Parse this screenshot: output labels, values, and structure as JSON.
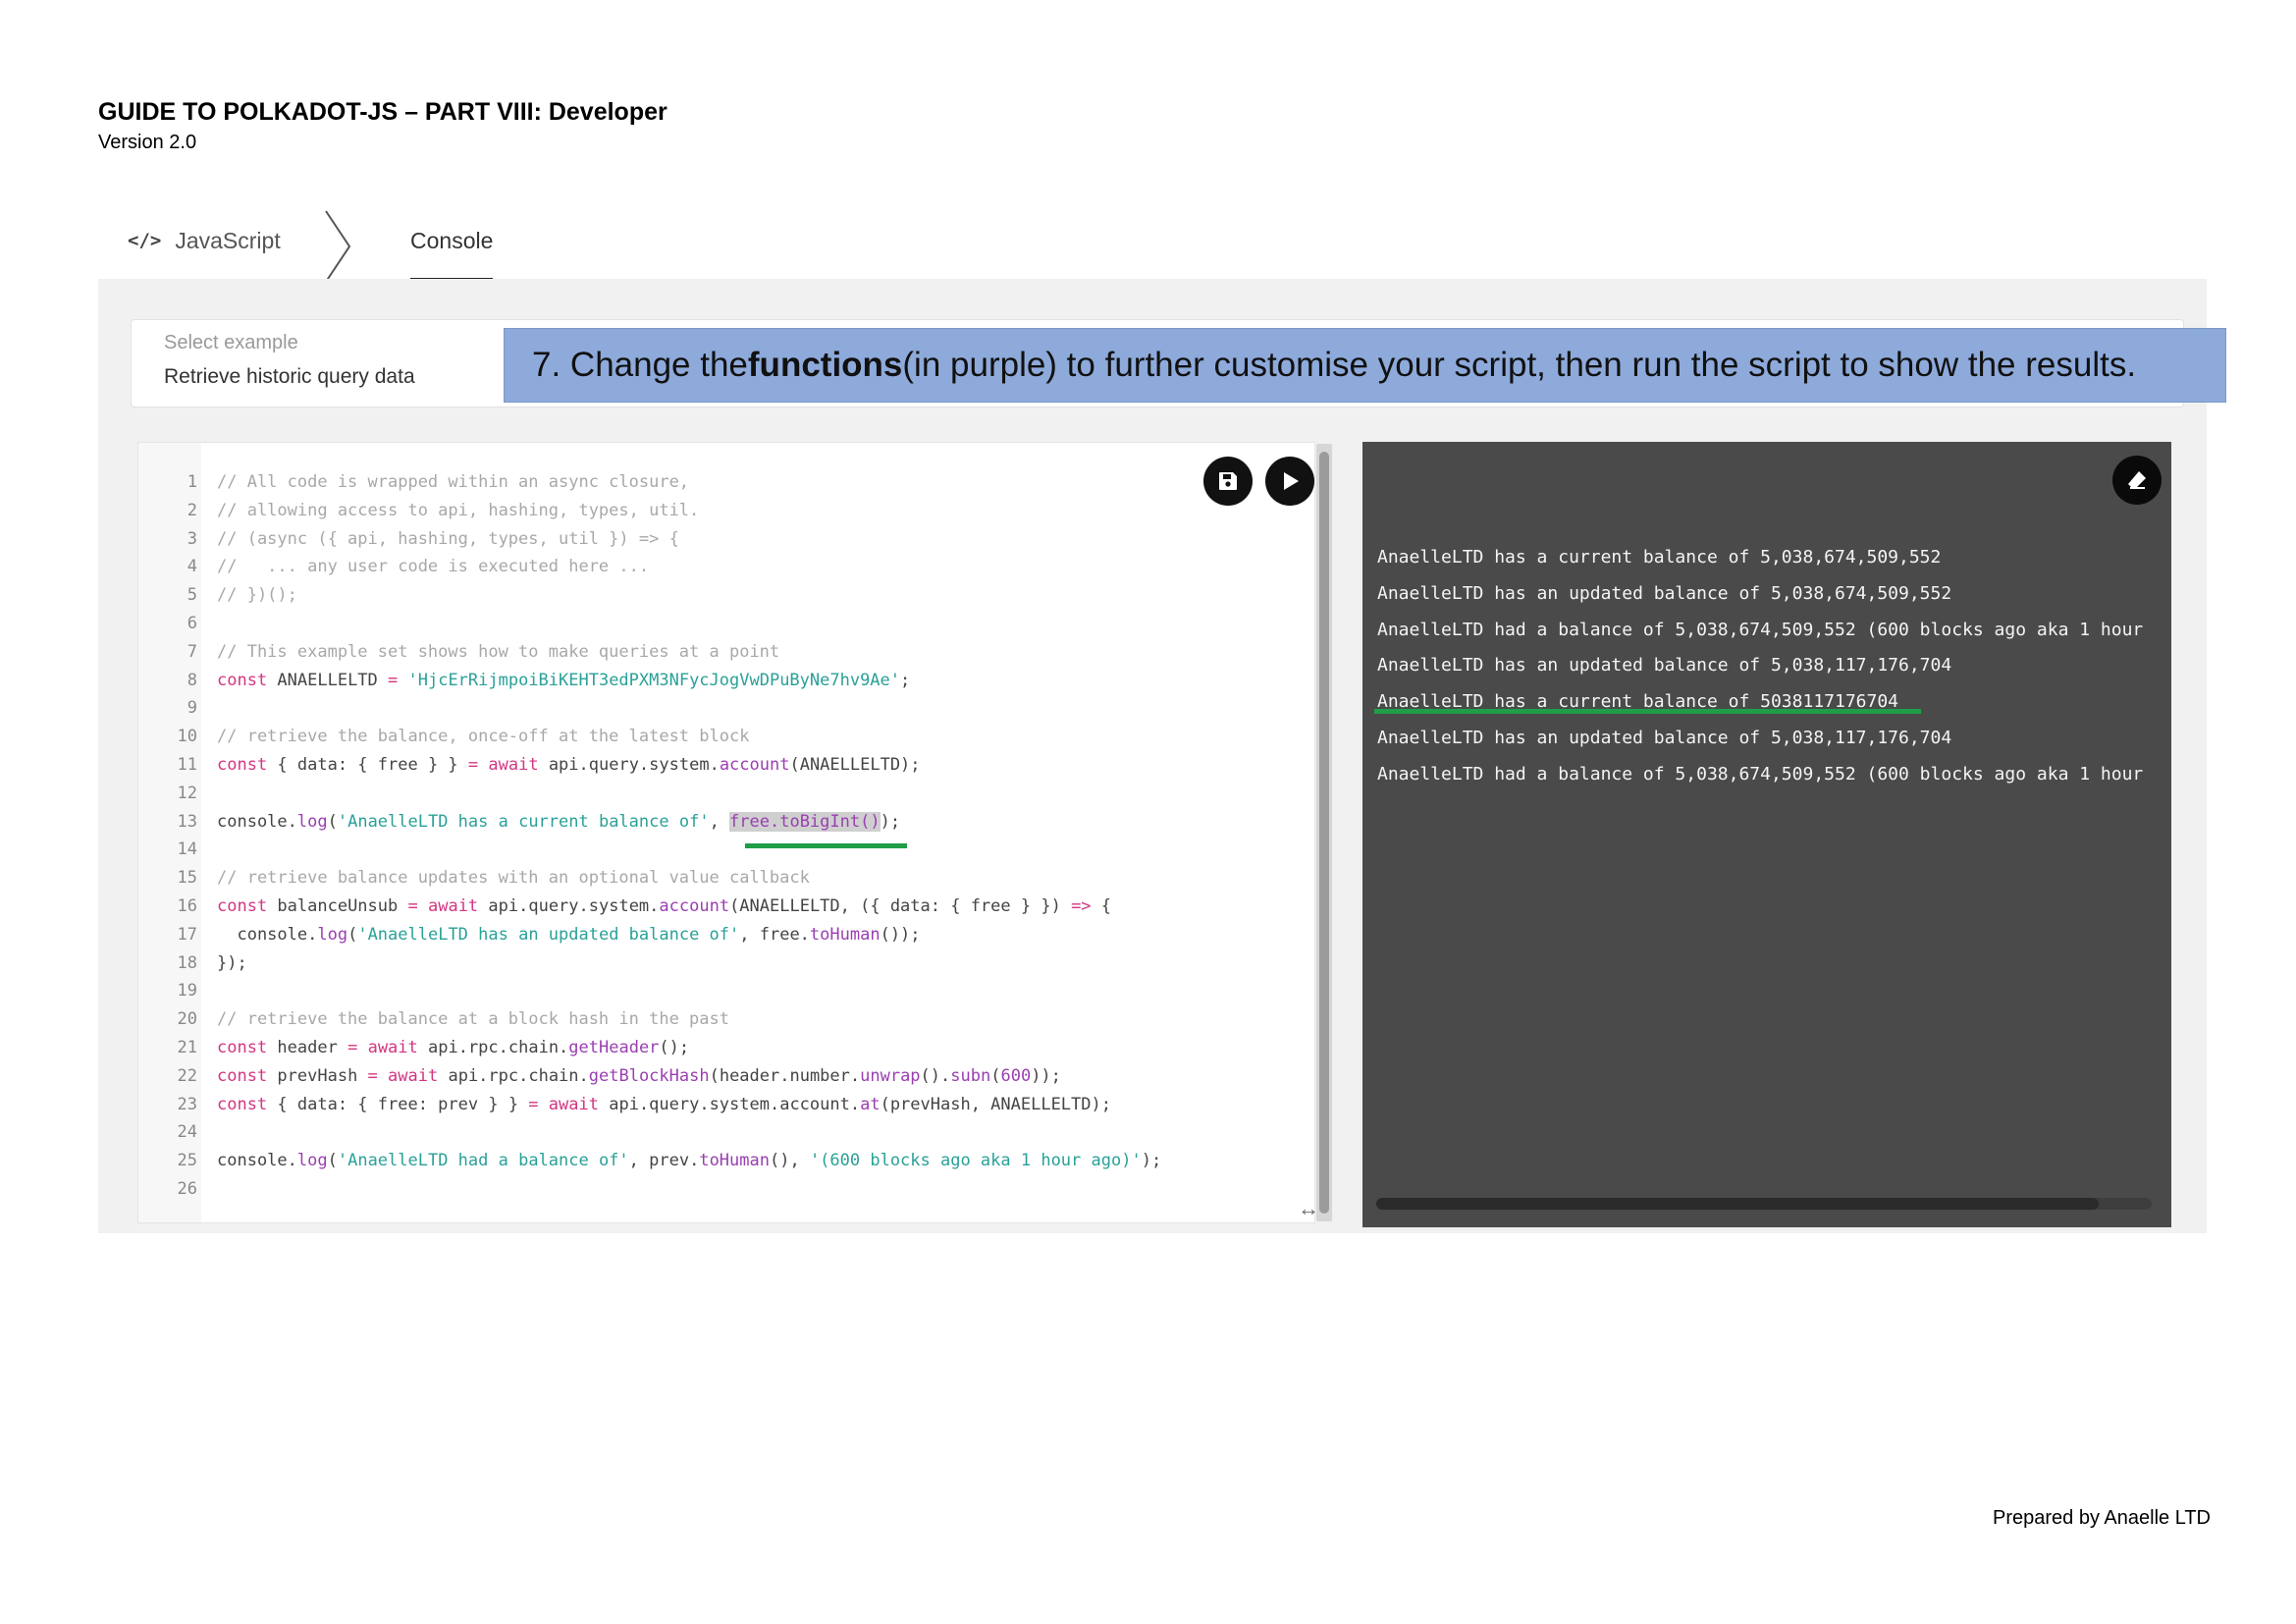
{
  "document": {
    "title": "GUIDE TO POLKADOT-JS – PART VIII: Developer",
    "version": "Version 2.0",
    "footer": "Prepared by Anaelle LTD"
  },
  "tabs": [
    {
      "label": "JavaScript",
      "icon": "code-icon",
      "active": false
    },
    {
      "label": "Console",
      "active": true
    }
  ],
  "example_select": {
    "label": "Select example",
    "value": "Retrieve historic query data"
  },
  "callout": {
    "before": "7. Change the ",
    "bold": "functions",
    "after": " (in purple) to further customise your script, then run the script to show the results."
  },
  "editor": {
    "lines": [
      {
        "n": "1",
        "tokens": [
          {
            "t": "// All code is wrapped within an async closure,",
            "c": "comment"
          }
        ]
      },
      {
        "n": "2",
        "tokens": [
          {
            "t": "// allowing access to api, hashing, types, util.",
            "c": "comment"
          }
        ]
      },
      {
        "n": "3",
        "tokens": [
          {
            "t": "// (async ({ api, hashing, types, util }) => {",
            "c": "comment"
          }
        ]
      },
      {
        "n": "4",
        "tokens": [
          {
            "t": "//   ... any user code is executed here ...",
            "c": "comment"
          }
        ]
      },
      {
        "n": "5",
        "tokens": [
          {
            "t": "// })();",
            "c": "comment"
          }
        ]
      },
      {
        "n": "6",
        "tokens": []
      },
      {
        "n": "7",
        "tokens": [
          {
            "t": "// This example set shows how to make queries at a point",
            "c": "comment"
          }
        ]
      },
      {
        "n": "8",
        "tokens": [
          {
            "t": "const",
            "c": "key"
          },
          {
            "t": " ANAELLELTD ",
            "c": "plain"
          },
          {
            "t": "=",
            "c": "key"
          },
          {
            "t": " 'HjcErRijmpoiBiKEHT3edPXM3NFycJogVwDPuByNe7hv9Ae'",
            "c": "str"
          },
          {
            "t": ";",
            "c": "plain"
          }
        ]
      },
      {
        "n": "9",
        "tokens": []
      },
      {
        "n": "10",
        "tokens": [
          {
            "t": "// retrieve the balance, once-off at the latest block",
            "c": "comment"
          }
        ]
      },
      {
        "n": "11",
        "tokens": [
          {
            "t": "const",
            "c": "key"
          },
          {
            "t": " { data: { free } } ",
            "c": "plain"
          },
          {
            "t": "=",
            "c": "key"
          },
          {
            "t": " ",
            "c": "plain"
          },
          {
            "t": "await",
            "c": "key"
          },
          {
            "t": " api.query.system.",
            "c": "plain"
          },
          {
            "t": "account",
            "c": "fn"
          },
          {
            "t": "(ANAELLELTD);",
            "c": "plain"
          }
        ]
      },
      {
        "n": "12",
        "tokens": []
      },
      {
        "n": "13",
        "tokens": [
          {
            "t": "console.",
            "c": "plain"
          },
          {
            "t": "log",
            "c": "fn"
          },
          {
            "t": "(",
            "c": "plain"
          },
          {
            "t": "'AnaelleLTD has a current balance of'",
            "c": "str"
          },
          {
            "t": ", ",
            "c": "plain"
          },
          {
            "t": "free.toBigInt()",
            "c": "fn",
            "hl": true
          },
          {
            "t": ");",
            "c": "plain"
          }
        ]
      },
      {
        "n": "14",
        "tokens": []
      },
      {
        "n": "15",
        "tokens": [
          {
            "t": "// retrieve balance updates with an optional value callback",
            "c": "comment"
          }
        ]
      },
      {
        "n": "16",
        "tokens": [
          {
            "t": "const",
            "c": "key"
          },
          {
            "t": " balanceUnsub ",
            "c": "plain"
          },
          {
            "t": "=",
            "c": "key"
          },
          {
            "t": " ",
            "c": "plain"
          },
          {
            "t": "await",
            "c": "key"
          },
          {
            "t": " api.query.system.",
            "c": "plain"
          },
          {
            "t": "account",
            "c": "fn"
          },
          {
            "t": "(ANAELLELTD, ({ data: { free } }) ",
            "c": "plain"
          },
          {
            "t": "=>",
            "c": "key"
          },
          {
            "t": " {",
            "c": "plain"
          }
        ]
      },
      {
        "n": "17",
        "tokens": [
          {
            "t": "  console.",
            "c": "plain"
          },
          {
            "t": "log",
            "c": "fn"
          },
          {
            "t": "(",
            "c": "plain"
          },
          {
            "t": "'AnaelleLTD has an updated balance of'",
            "c": "str"
          },
          {
            "t": ", free.",
            "c": "plain"
          },
          {
            "t": "toHuman",
            "c": "fn"
          },
          {
            "t": "());",
            "c": "plain"
          }
        ]
      },
      {
        "n": "18",
        "tokens": [
          {
            "t": "});",
            "c": "plain"
          }
        ]
      },
      {
        "n": "19",
        "tokens": []
      },
      {
        "n": "20",
        "tokens": [
          {
            "t": "// retrieve the balance at a block hash in the past",
            "c": "comment"
          }
        ]
      },
      {
        "n": "21",
        "tokens": [
          {
            "t": "const",
            "c": "key"
          },
          {
            "t": " header ",
            "c": "plain"
          },
          {
            "t": "=",
            "c": "key"
          },
          {
            "t": " ",
            "c": "plain"
          },
          {
            "t": "await",
            "c": "key"
          },
          {
            "t": " api.rpc.chain.",
            "c": "plain"
          },
          {
            "t": "getHeader",
            "c": "fn"
          },
          {
            "t": "();",
            "c": "plain"
          }
        ]
      },
      {
        "n": "22",
        "tokens": [
          {
            "t": "const",
            "c": "key"
          },
          {
            "t": " prevHash ",
            "c": "plain"
          },
          {
            "t": "=",
            "c": "key"
          },
          {
            "t": " ",
            "c": "plain"
          },
          {
            "t": "await",
            "c": "key"
          },
          {
            "t": " api.rpc.chain.",
            "c": "plain"
          },
          {
            "t": "getBlockHash",
            "c": "fn"
          },
          {
            "t": "(header.number.",
            "c": "plain"
          },
          {
            "t": "unwrap",
            "c": "fn"
          },
          {
            "t": "().",
            "c": "plain"
          },
          {
            "t": "subn",
            "c": "fn"
          },
          {
            "t": "(",
            "c": "plain"
          },
          {
            "t": "600",
            "c": "fn"
          },
          {
            "t": "));",
            "c": "plain"
          }
        ]
      },
      {
        "n": "23",
        "tokens": [
          {
            "t": "const",
            "c": "key"
          },
          {
            "t": " { data: { free: prev } } ",
            "c": "plain"
          },
          {
            "t": "=",
            "c": "key"
          },
          {
            "t": " ",
            "c": "plain"
          },
          {
            "t": "await",
            "c": "key"
          },
          {
            "t": " api.query.system.account.",
            "c": "plain"
          },
          {
            "t": "at",
            "c": "fn"
          },
          {
            "t": "(prevHash, ANAELLELTD);",
            "c": "plain"
          }
        ]
      },
      {
        "n": "24",
        "tokens": []
      },
      {
        "n": "25",
        "tokens": [
          {
            "t": "console.",
            "c": "plain"
          },
          {
            "t": "log",
            "c": "fn"
          },
          {
            "t": "(",
            "c": "plain"
          },
          {
            "t": "'AnaelleLTD had a balance of'",
            "c": "str"
          },
          {
            "t": ", prev.",
            "c": "plain"
          },
          {
            "t": "toHuman",
            "c": "fn"
          },
          {
            "t": "(), ",
            "c": "plain"
          },
          {
            "t": "'(600 blocks ago aka 1 hour ago)'",
            "c": "str"
          },
          {
            "t": ");",
            "c": "plain"
          }
        ]
      },
      {
        "n": "26",
        "tokens": []
      }
    ],
    "buttons": [
      {
        "name": "save-button",
        "icon": "save-icon"
      },
      {
        "name": "run-button",
        "icon": "play-icon"
      }
    ]
  },
  "console": {
    "lines": [
      "AnaelleLTD has a current balance of 5,038,674,509,552",
      "AnaelleLTD has an updated balance of 5,038,674,509,552",
      "AnaelleLTD had a balance of 5,038,674,509,552 (600 blocks ago aka 1 hour",
      "AnaelleLTD has an updated balance of 5,038,117,176,704",
      "AnaelleLTD has a current balance of 5038117176704",
      "AnaelleLTD has an updated balance of 5,038,117,176,704",
      "AnaelleLTD had a balance of 5,038,674,509,552 (600 blocks ago aka 1 hour"
    ],
    "clear_icon": "eraser-icon"
  },
  "colors": {
    "callout_bg": "#8eaadb",
    "highlight_underline": "#1e9e48",
    "console_bg": "#4a4a4a",
    "keyword": "#d33682",
    "function": "#9a3fb1",
    "string": "#2aa198"
  }
}
